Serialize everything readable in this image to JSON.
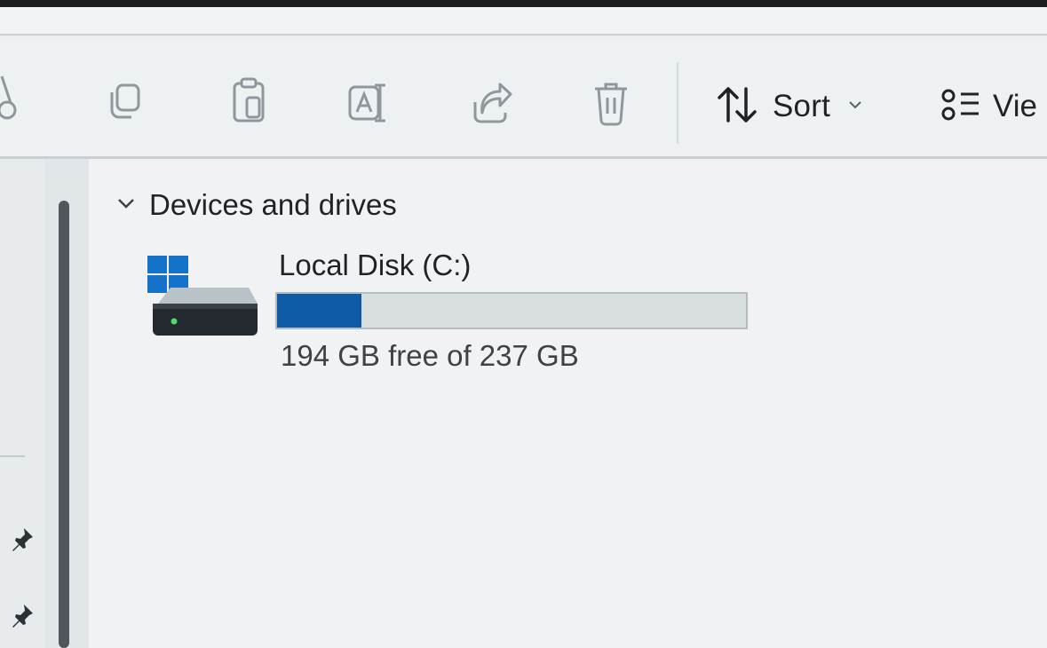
{
  "toolbar": {
    "buttons": [
      {
        "name": "cut",
        "icon": "scissors-icon"
      },
      {
        "name": "copy",
        "icon": "copy-icon"
      },
      {
        "name": "paste",
        "icon": "clipboard-icon"
      },
      {
        "name": "rename",
        "icon": "rename-icon"
      },
      {
        "name": "share",
        "icon": "share-icon"
      },
      {
        "name": "delete",
        "icon": "trash-icon"
      }
    ],
    "sort_label": "Sort",
    "view_label": "Vie"
  },
  "main": {
    "group_title": "Devices and drives",
    "drives": [
      {
        "name": "Local Disk (C:)",
        "free_text": "194 GB free of 237 GB",
        "used_fraction": 0.18
      }
    ]
  },
  "colors": {
    "accent": "#0f5ba8",
    "windows_logo": "#1473c8"
  }
}
